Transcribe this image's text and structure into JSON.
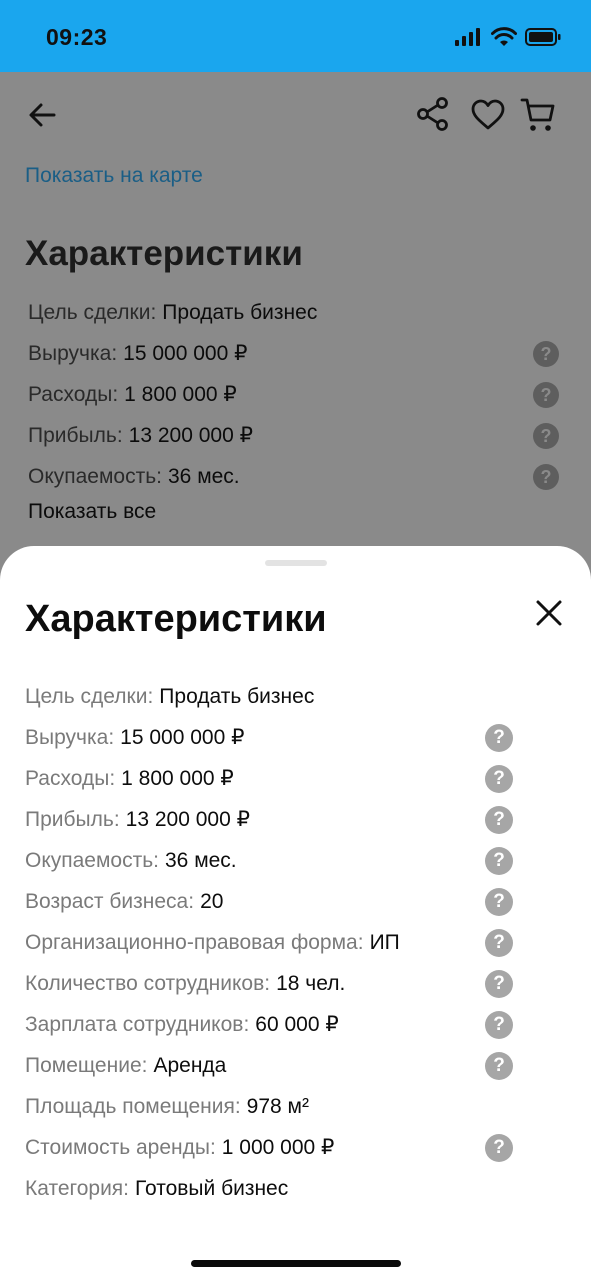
{
  "status_bar": {
    "time": "09:23"
  },
  "page": {
    "map_link": "Показать на карте",
    "heading": "Характеристики",
    "rows": [
      {
        "label": "Цель сделки:",
        "value": "Продать бизнес",
        "help": false
      },
      {
        "label": "Выручка:",
        "value": "15 000 000 ₽",
        "help": true
      },
      {
        "label": "Расходы:",
        "value": "1 800 000 ₽",
        "help": true
      },
      {
        "label": "Прибыль:",
        "value": "13 200 000 ₽",
        "help": true
      },
      {
        "label": "Окупаемость:",
        "value": "36 мес.",
        "help": true
      }
    ],
    "show_all": "Показать все",
    "help_glyph": "?"
  },
  "sheet": {
    "title": "Характеристики",
    "help_glyph": "?",
    "rows": [
      {
        "label": "Цель сделки:",
        "value": "Продать бизнес",
        "help": false
      },
      {
        "label": "Выручка:",
        "value": "15 000 000 ₽",
        "help": true
      },
      {
        "label": "Расходы:",
        "value": "1 800 000 ₽",
        "help": true
      },
      {
        "label": "Прибыль:",
        "value": "13 200 000 ₽",
        "help": true
      },
      {
        "label": "Окупаемость:",
        "value": "36 мес.",
        "help": true
      },
      {
        "label": "Возраст бизнеса:",
        "value": "20",
        "help": true
      },
      {
        "label": "Организационно-правовая форма:",
        "value": "ИП",
        "help": true
      },
      {
        "label": "Количество сотрудников:",
        "value": "18 чел.",
        "help": true
      },
      {
        "label": "Зарплата сотрудников:",
        "value": "60 000 ₽",
        "help": true
      },
      {
        "label": "Помещение:",
        "value": "Аренда",
        "help": true
      },
      {
        "label": "Площадь помещения:",
        "value": "978 м²",
        "help": false
      },
      {
        "label": "Стоимость аренды:",
        "value": "1 000 000 ₽",
        "help": true
      },
      {
        "label": "Категория:",
        "value": "Готовый бизнес",
        "help": false
      }
    ]
  },
  "icons": {
    "back": "arrow-left-icon",
    "share": "share-icon",
    "favorite": "heart-icon",
    "cart": "cart-icon",
    "close": "close-icon",
    "help": "question-circle-icon"
  },
  "colors": {
    "status_bar": "#1aa6ee",
    "link": "#1a5e86",
    "help_icon": "#a6a6a6",
    "label": "#7a7a7a"
  }
}
